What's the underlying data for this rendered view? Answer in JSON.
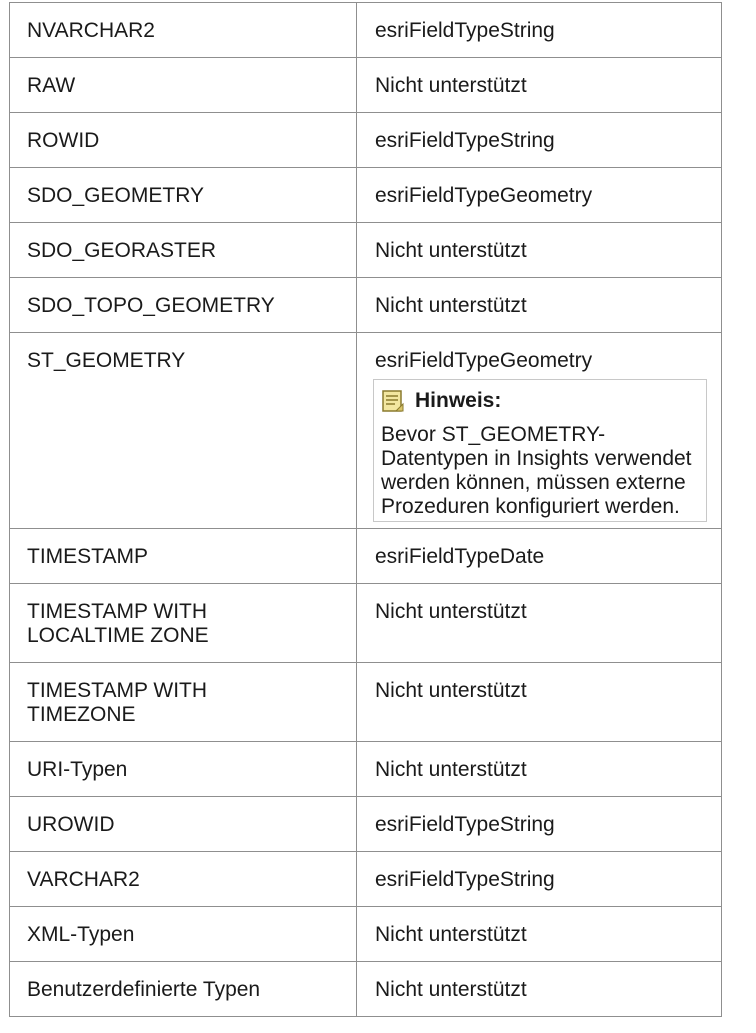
{
  "table": {
    "rows": [
      {
        "type": "NVARCHAR2",
        "mapping": "esriFieldTypeString"
      },
      {
        "type": "RAW",
        "mapping": "Nicht unterstützt"
      },
      {
        "type": "ROWID",
        "mapping": "esriFieldTypeString"
      },
      {
        "type": "SDO_GEOMETRY",
        "mapping": "esriFieldTypeGeometry"
      },
      {
        "type": "SDO_GEORASTER",
        "mapping": "Nicht unterstützt"
      },
      {
        "type": "SDO_TOPO_GEOMETRY",
        "mapping": "Nicht unterstützt"
      },
      {
        "type": "ST_GEOMETRY",
        "mapping": "esriFieldTypeGeometry",
        "note": {
          "icon": "note-icon",
          "title": "Hinweis:",
          "text": "Bevor ST_GEOMETRY-Datentypen in Insights verwendet werden können, müssen externe Prozeduren konfiguriert werden."
        }
      },
      {
        "type": "TIMESTAMP",
        "mapping": "esriFieldTypeDate"
      },
      {
        "type": "TIMESTAMP WITH LOCALTIME ZONE",
        "mapping": "Nicht unterstützt"
      },
      {
        "type": "TIMESTAMP WITH TIMEZONE",
        "mapping": "Nicht unterstützt"
      },
      {
        "type": "URI-Typen",
        "mapping": "Nicht unterstützt"
      },
      {
        "type": "UROWID",
        "mapping": "esriFieldTypeString"
      },
      {
        "type": "VARCHAR2",
        "mapping": "esriFieldTypeString"
      },
      {
        "type": "XML-Typen",
        "mapping": "Nicht unterstützt"
      },
      {
        "type": "Benutzerdefinierte Typen",
        "mapping": "Nicht unterstützt"
      }
    ]
  },
  "colors": {
    "border": "#8f8f8f",
    "note_border": "#c8c8c8",
    "note_icon_fill": "#f2e6a0",
    "note_icon_stroke": "#8a7a2e"
  }
}
